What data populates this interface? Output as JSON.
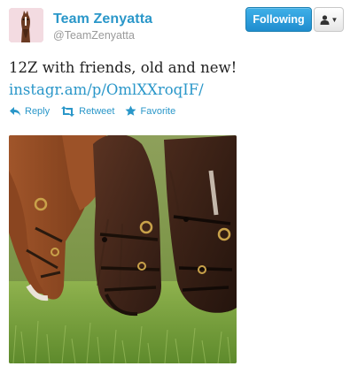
{
  "profile": {
    "name": "Team Zenyatta",
    "handle": "@TeamZenyatta"
  },
  "buttons": {
    "follow_label": "Following",
    "user_menu_icon": "user-icon"
  },
  "tweet": {
    "text": "12Z with friends, old and new!",
    "link": "instagr.am/p/OmlXXroqIF/"
  },
  "actions": [
    {
      "label": "Reply",
      "icon": "reply-icon"
    },
    {
      "label": "Retweet",
      "icon": "retweet-icon"
    },
    {
      "label": "Favorite",
      "icon": "star-icon"
    }
  ],
  "colors": {
    "link": "#2a97c9",
    "follow_button": "#1f8dcf"
  }
}
